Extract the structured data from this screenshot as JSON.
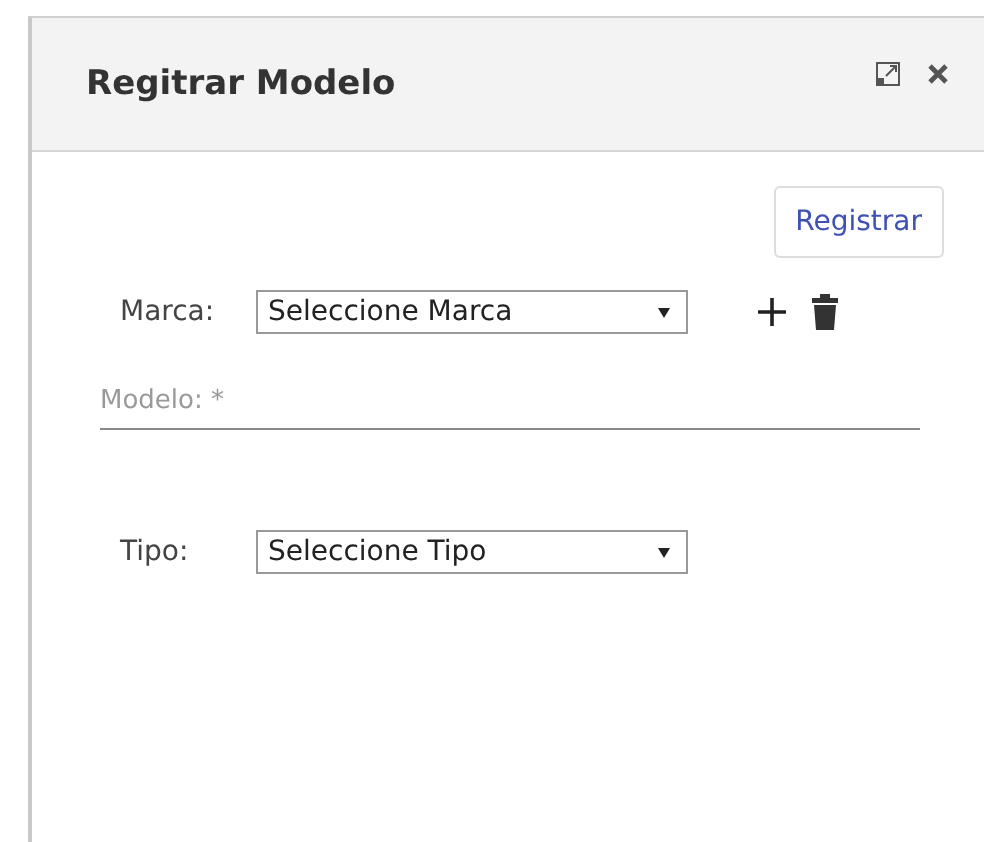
{
  "dialog": {
    "title": "Regitrar Modelo"
  },
  "submit_button": {
    "label": "Registrar"
  },
  "brand": {
    "label": "Marca:",
    "value": "Seleccione Marca"
  },
  "model": {
    "placeholder": "Modelo: *"
  },
  "type": {
    "label": "Tipo:",
    "value": "Seleccione Tipo"
  }
}
